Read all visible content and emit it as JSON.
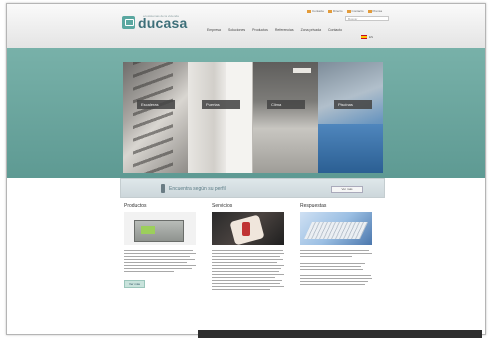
{
  "brand": {
    "name": "ducasa",
    "tagline": "ecosistemas de la vivienda"
  },
  "utility_links": [
    "Contacte",
    "Directo",
    "Contacto",
    "Prensa"
  ],
  "search": {
    "placeholder": "Buscar"
  },
  "nav": [
    "Empresa",
    "Soluciones",
    "Productos",
    "Referencias",
    "Zona privada",
    "Contacto"
  ],
  "lang": {
    "label": "ES"
  },
  "hero_panels": [
    {
      "label": "Escaleras"
    },
    {
      "label": "Puertas"
    },
    {
      "label": "Clima"
    },
    {
      "label": "Piscinas"
    }
  ],
  "banner": {
    "text": "Encuentra según su perfil",
    "button": "Ver más"
  },
  "columns": [
    {
      "title": "Productos",
      "link": "Ver más"
    },
    {
      "title": "Servicios"
    },
    {
      "title": "Respuestas"
    }
  ],
  "colors": {
    "teal": "#6aa69f",
    "brand": "#3d6f79",
    "accent": "#e39b3a"
  }
}
